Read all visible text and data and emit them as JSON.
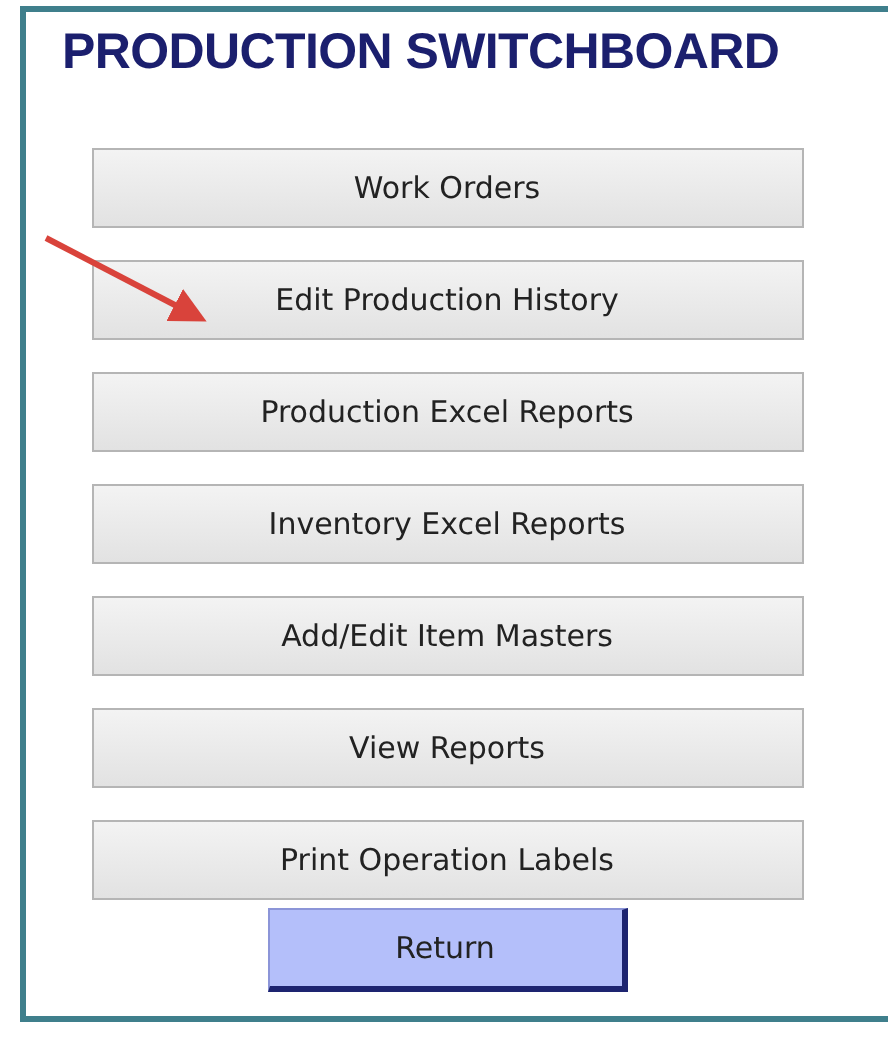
{
  "title": "PRODUCTION SWITCHBOARD",
  "buttons": [
    {
      "label": "Work Orders",
      "kind": "menu"
    },
    {
      "label": "Edit Production History",
      "kind": "menu"
    },
    {
      "label": "Production Excel Reports",
      "kind": "menu"
    },
    {
      "label": "Inventory Excel Reports",
      "kind": "menu"
    },
    {
      "label": "Add/Edit Item Masters",
      "kind": "menu"
    },
    {
      "label": "View Reports",
      "kind": "menu"
    },
    {
      "label": "Print Operation Labels",
      "kind": "menu"
    },
    {
      "label": "Return",
      "kind": "return"
    }
  ]
}
